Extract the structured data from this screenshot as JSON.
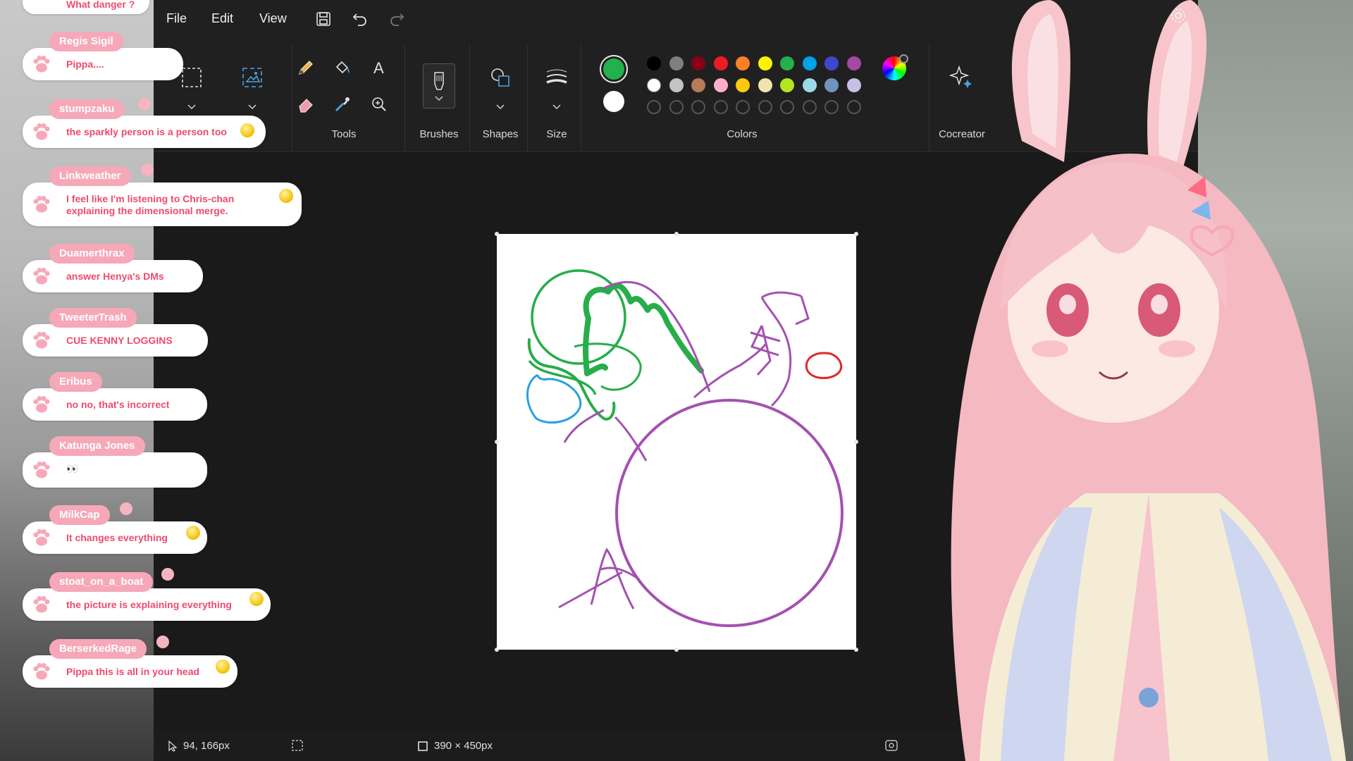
{
  "menu": {
    "file": "File",
    "edit": "Edit",
    "view": "View"
  },
  "ribbon": {
    "tools_label": "Tools",
    "brushes_label": "Brushes",
    "shapes_label": "Shapes",
    "size_label": "Size",
    "colors_label": "Colors",
    "cocreator_label": "Cocreator",
    "primary_color": "#22b14c",
    "secondary_color": "#ffffff",
    "palette_row1": [
      "#000000",
      "#7f7f7f",
      "#880015",
      "#ed1c24",
      "#ff7f27",
      "#fff200",
      "#22b14c",
      "#00a2e8",
      "#3f48cc",
      "#a349a4"
    ],
    "palette_row2": [
      "#ffffff",
      "#c3c3c3",
      "#b97a57",
      "#ffaec9",
      "#ffc90e",
      "#efe4b0",
      "#b5e61d",
      "#99d9ea",
      "#7092be",
      "#c8bfe7"
    ]
  },
  "status": {
    "cursor_position": "94, 166px",
    "canvas_size": "390 × 450px"
  },
  "chat": {
    "top_partial": "What danger ?",
    "messages": [
      {
        "user": "Regis Sigil",
        "text": "Pippa...."
      },
      {
        "user": "stumpzaku",
        "text": "the sparkly person is a person too"
      },
      {
        "user": "Linkweather",
        "text": "I feel like I'm listening to Chris-chan",
        "text2": "explaining the dimensional merge."
      },
      {
        "user": "Duamerthrax",
        "text": "answer Henya's DMs"
      },
      {
        "user": "TweeterTrash",
        "text": "CUE KENNY LOGGINS"
      },
      {
        "user": "Eribus",
        "text": "no no, that's incorrect"
      },
      {
        "user": "Katunga Jones",
        "text": "👀"
      },
      {
        "user": "MilkCap",
        "text": "It changes everything"
      },
      {
        "user": "stoat_on_a_boat",
        "text": "the picture is explaining everything"
      },
      {
        "user": "BerserkedRage",
        "text": "Pippa this is all in your head"
      }
    ]
  }
}
